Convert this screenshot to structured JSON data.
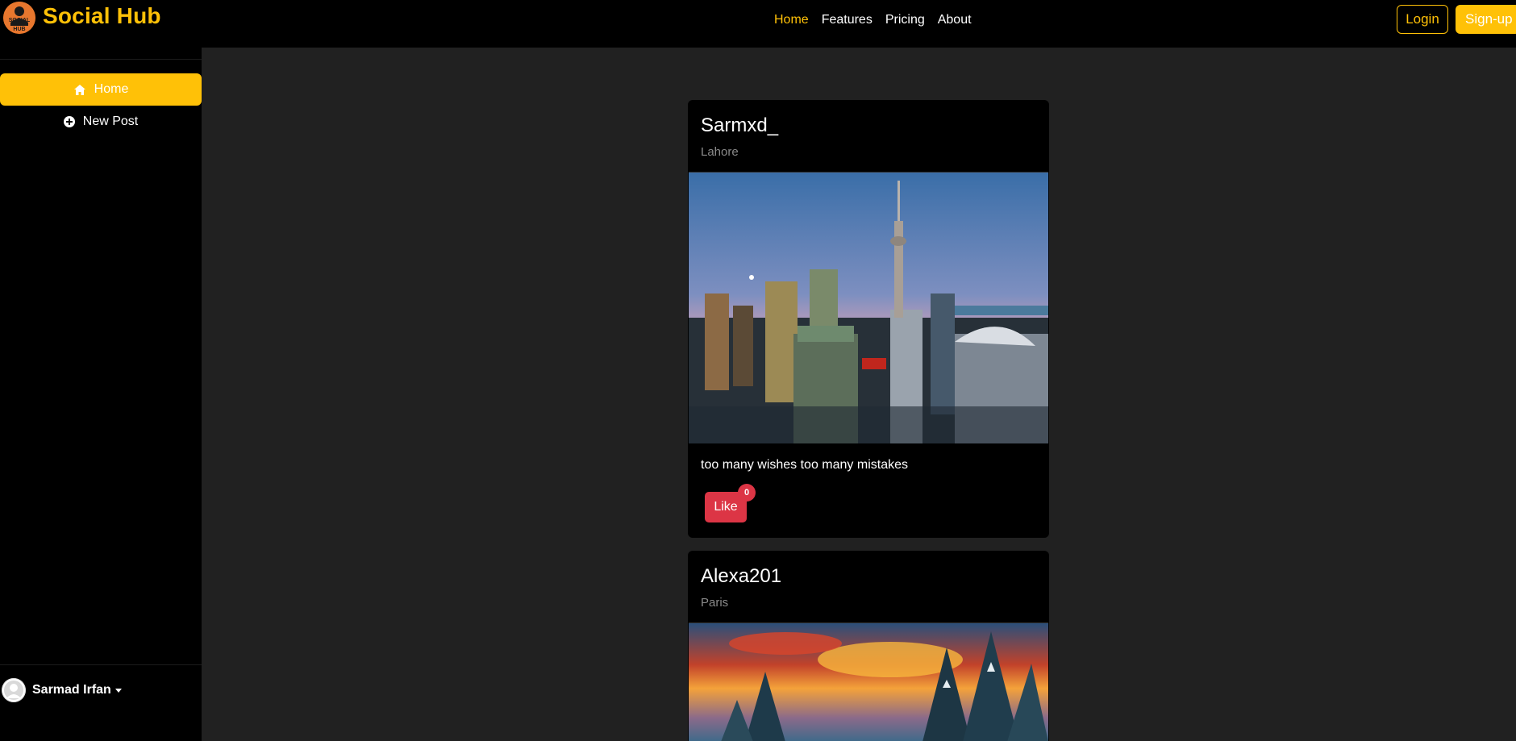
{
  "navbar": {
    "brand_logo_text": "SOCIAL HUB",
    "brand_name": "Social Hub",
    "links": [
      "Home",
      "Features",
      "Pricing",
      "About"
    ],
    "active_link": "Home",
    "login_label": "Login",
    "signup_label": "Sign-up"
  },
  "sidebar": {
    "items": [
      {
        "label": "Home",
        "icon": "home-icon",
        "active": true
      },
      {
        "label": "New Post",
        "icon": "plus-circle-icon",
        "active": false
      }
    ],
    "user": {
      "name": "Sarmad Irfan"
    }
  },
  "posts": [
    {
      "username": "Sarmxd_",
      "location": "Lahore",
      "caption": "too many wishes too many mistakes",
      "like_label": "Like",
      "like_count": "0",
      "image": "city skyline with tower at dusk"
    },
    {
      "username": "Alexa201",
      "location": "Paris",
      "image": "fiery sunset sky over snowy pine trees"
    }
  ],
  "colors": {
    "accent": "#ffc107",
    "danger": "#dc3545",
    "navbar_bg": "#000000",
    "content_bg": "#212121"
  }
}
